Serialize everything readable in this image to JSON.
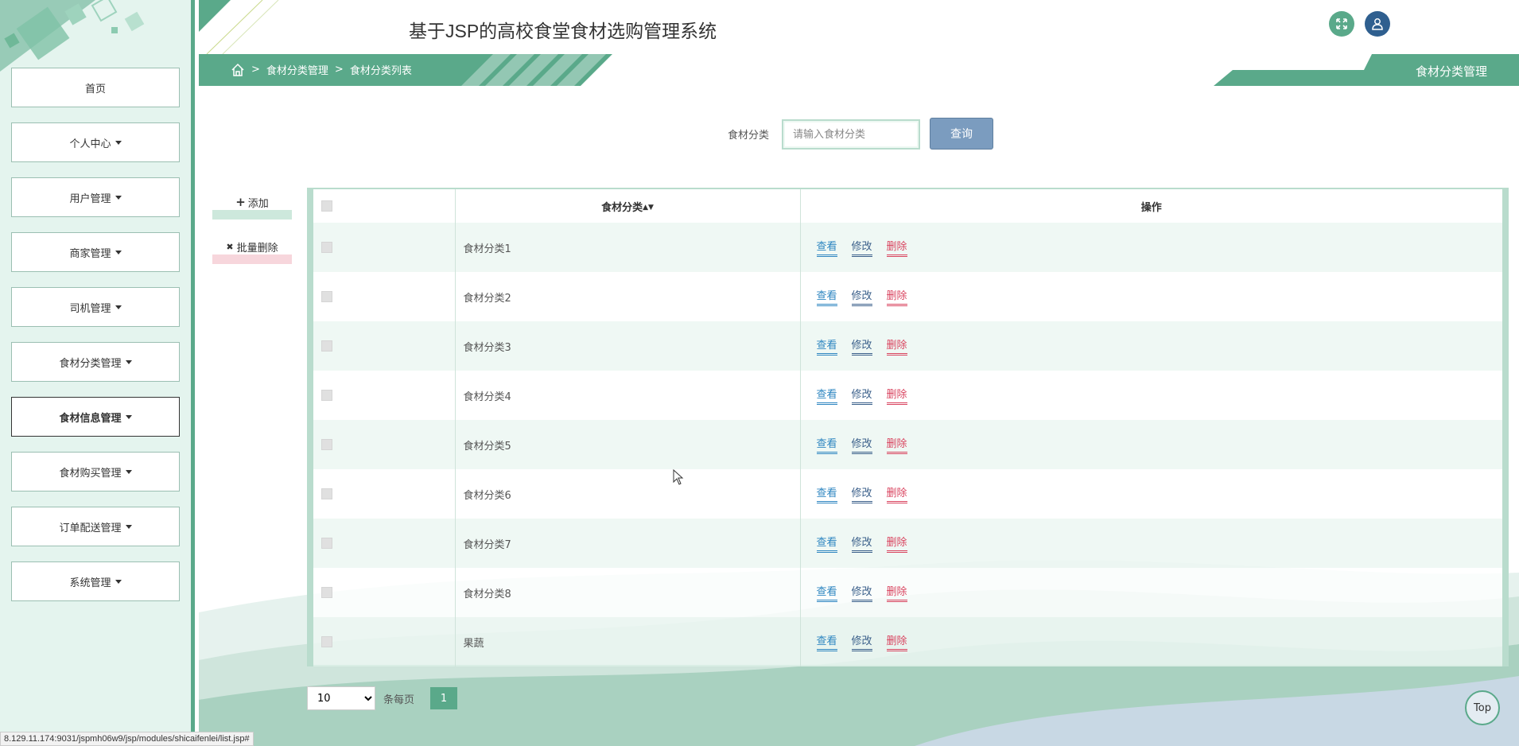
{
  "header": {
    "title": "基于JSP的高校食堂食材选购管理系统"
  },
  "breadcrumb": {
    "sep": ">",
    "level1": "食材分类管理",
    "level2": "食材分类列表"
  },
  "page_tag": "食材分类管理",
  "sidebar": {
    "items": [
      {
        "label": "首页",
        "caret": false,
        "active": false
      },
      {
        "label": "个人中心",
        "caret": true,
        "active": false
      },
      {
        "label": "用户管理",
        "caret": true,
        "active": false
      },
      {
        "label": "商家管理",
        "caret": true,
        "active": false
      },
      {
        "label": "司机管理",
        "caret": true,
        "active": false
      },
      {
        "label": "食材分类管理",
        "caret": true,
        "active": false
      },
      {
        "label": "食材信息管理",
        "caret": true,
        "active": true
      },
      {
        "label": "食材购买管理",
        "caret": true,
        "active": false
      },
      {
        "label": "订单配送管理",
        "caret": true,
        "active": false
      },
      {
        "label": "系统管理",
        "caret": true,
        "active": false
      }
    ]
  },
  "search": {
    "label": "食材分类",
    "placeholder": "请输入食材分类",
    "button": "查询"
  },
  "actions": {
    "add": "添加",
    "add_icon": "+",
    "batch_delete": "批量删除",
    "batch_delete_icon": "✖"
  },
  "table": {
    "col_name": "食材分类",
    "col_op": "操作",
    "rows": [
      {
        "name": "食材分类1"
      },
      {
        "name": "食材分类2"
      },
      {
        "name": "食材分类3"
      },
      {
        "name": "食材分类4"
      },
      {
        "name": "食材分类5"
      },
      {
        "name": "食材分类6"
      },
      {
        "name": "食材分类7"
      },
      {
        "name": "食材分类8"
      },
      {
        "name": "果蔬"
      }
    ],
    "ops": {
      "view": "查看",
      "edit": "修改",
      "delete": "删除"
    }
  },
  "pager": {
    "page_size": "10",
    "per_page_label": "条每页",
    "current_page": "1"
  },
  "top_button": "Top",
  "status_url": "8.129.11.174:9031/jspmh06w9/jsp/modules/shicaifenlei/list.jsp#",
  "colors": {
    "accent": "#5aa98a",
    "sidebar_bg": "#e4f4ee",
    "view": "#2e86c1",
    "edit": "#3a5f8a",
    "delete": "#d9445f",
    "search_btn": "#7b9cbf"
  }
}
